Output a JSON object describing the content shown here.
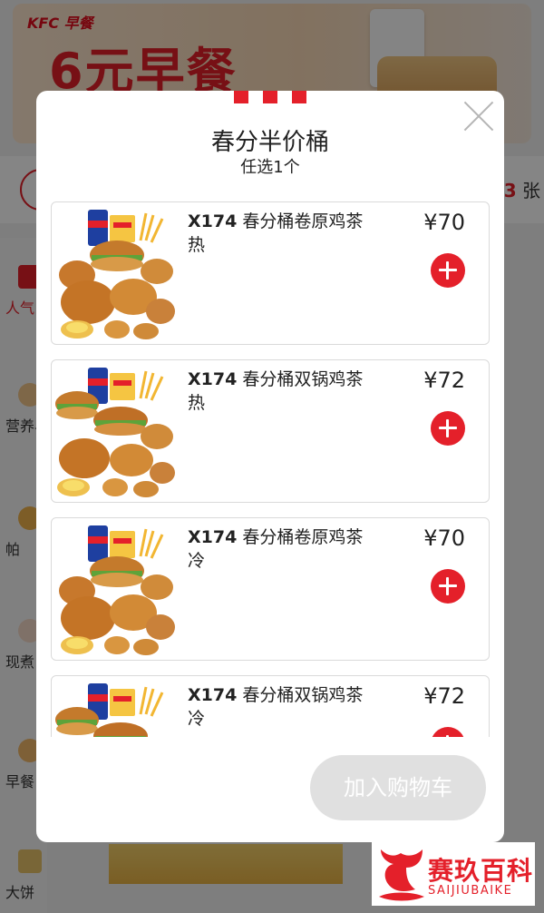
{
  "background": {
    "banner": {
      "brand": "KFC 早餐",
      "headline": "6元早餐"
    },
    "coupon_count_prefix": "3",
    "coupon_count_suffix": " 张",
    "sidebar": [
      {
        "label": "人气"
      },
      {
        "label": "营养早"
      },
      {
        "label": "帕"
      },
      {
        "label": "现煮"
      },
      {
        "label": "早餐"
      },
      {
        "label": "大饼"
      }
    ]
  },
  "modal": {
    "title": "春分半价桶",
    "subtitle": "任选1个",
    "close_icon": "close-icon",
    "items": [
      {
        "code": "X174",
        "name": "春分桶卷原鸡茶热",
        "price": "¥70"
      },
      {
        "code": "X174",
        "name": "春分桶双锅鸡茶热",
        "price": "¥72"
      },
      {
        "code": "X174",
        "name": "春分桶卷原鸡茶冷",
        "price": "¥70"
      },
      {
        "code": "X174",
        "name": "春分桶双锅鸡茶冷",
        "price": "¥72"
      }
    ],
    "add_to_cart_label": "加入购物车"
  },
  "watermark": {
    "name_cn": "赛玖百科",
    "name_en": "SAIJIUBAIKE"
  },
  "colors": {
    "accent": "#e4202a",
    "disabled_button": "#e0e0e0"
  }
}
